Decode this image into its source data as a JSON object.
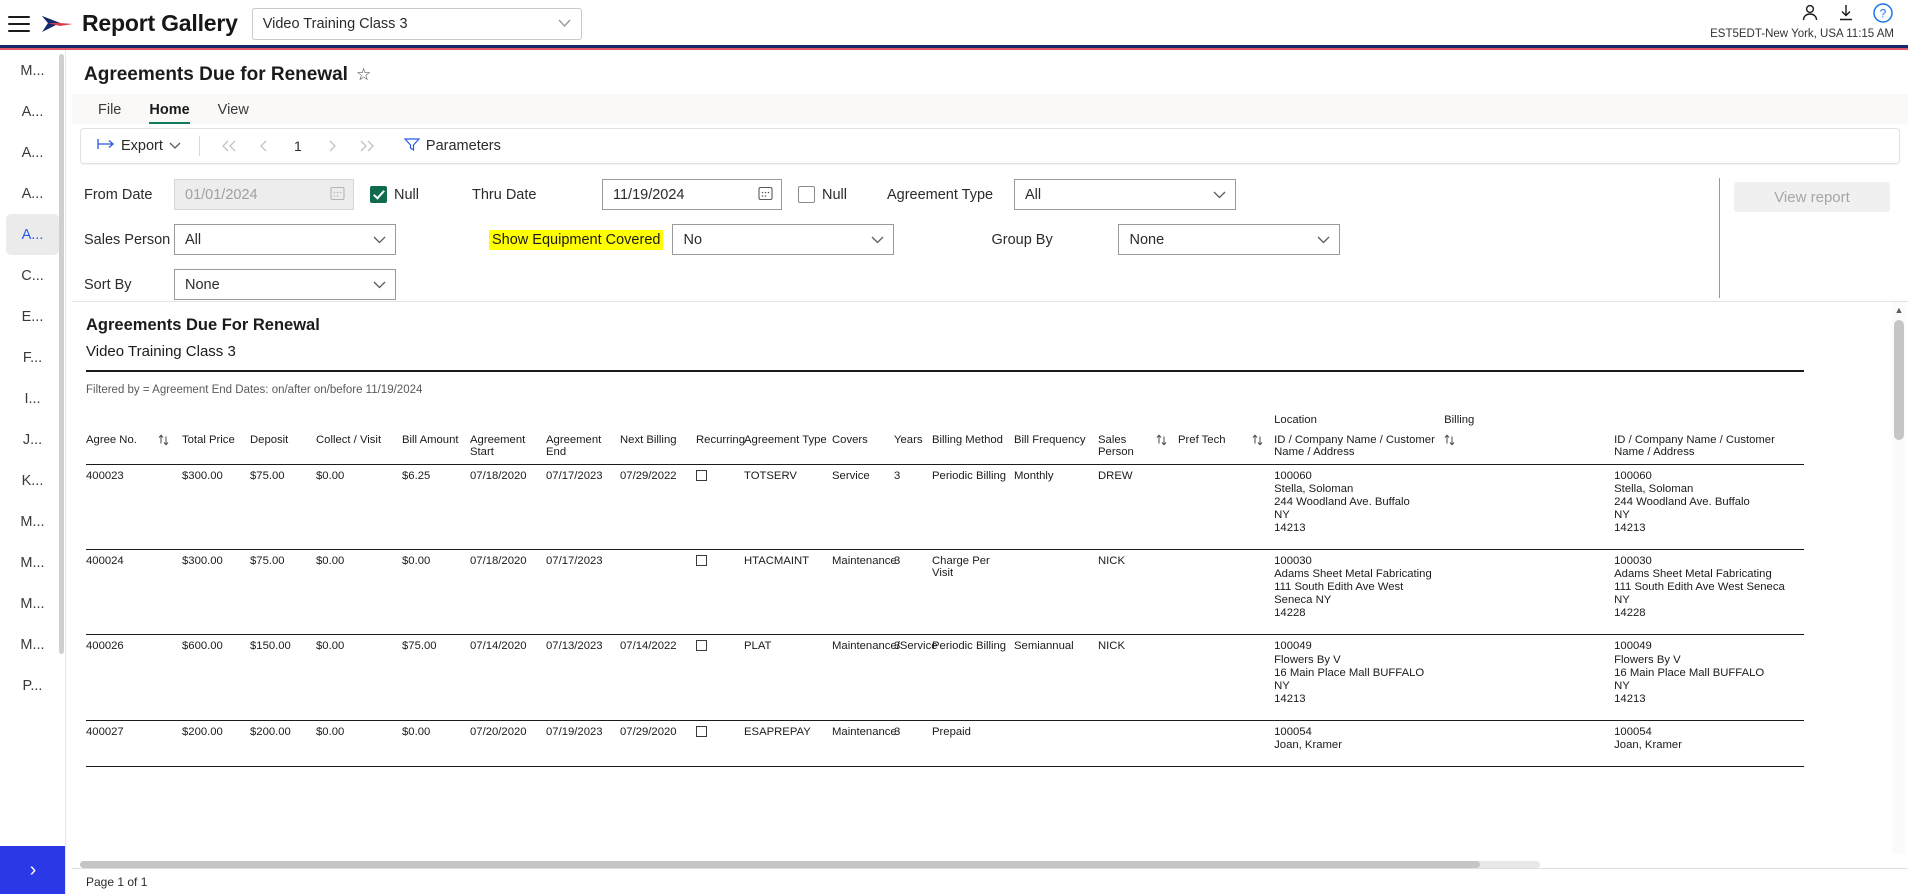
{
  "appbar": {
    "menu_icon": "hamburger-icon",
    "brand": "Report Gallery",
    "class_selector_value": "Video Training Class 3",
    "account_icon": "person-icon",
    "download_icon": "download-icon",
    "help_icon": "help-icon",
    "timezone": "EST5EDT-New York, USA 11:15 AM"
  },
  "rail": {
    "items": [
      {
        "label": "M...",
        "active": false
      },
      {
        "label": "A...",
        "active": false
      },
      {
        "label": "A...",
        "active": false
      },
      {
        "label": "A...",
        "active": false
      },
      {
        "label": "A...",
        "active": true
      },
      {
        "label": "C...",
        "active": false
      },
      {
        "label": "E...",
        "active": false
      },
      {
        "label": "F...",
        "active": false
      },
      {
        "label": "I...",
        "active": false
      },
      {
        "label": "J...",
        "active": false
      },
      {
        "label": "K...",
        "active": false
      },
      {
        "label": "M...",
        "active": false
      },
      {
        "label": "M...",
        "active": false
      },
      {
        "label": "M...",
        "active": false
      },
      {
        "label": "M...",
        "active": false
      },
      {
        "label": "P...",
        "active": false
      }
    ],
    "expand_label": "›"
  },
  "report": {
    "title": "Agreements Due for Renewal",
    "favorite_icon": "star-icon",
    "tabs": [
      {
        "label": "File",
        "active": false
      },
      {
        "label": "Home",
        "active": true
      },
      {
        "label": "View",
        "active": false
      }
    ],
    "toolbar": {
      "export_label": "Export",
      "page_number": "1",
      "parameters_label": "Parameters",
      "first_icon": "first-page-icon",
      "prev_icon": "previous-page-icon",
      "next_icon": "next-page-icon",
      "last_icon": "last-page-icon",
      "filter_icon": "filter-icon"
    }
  },
  "parameters": {
    "from_date": {
      "label": "From Date",
      "value": "01/01/2024",
      "null_label": "Null",
      "null_checked": true,
      "disabled": true
    },
    "thru_date": {
      "label": "Thru Date",
      "value": "11/19/2024",
      "null_label": "Null",
      "null_checked": false,
      "disabled": false
    },
    "agreement_type": {
      "label": "Agreement Type",
      "value": "All"
    },
    "sales_person": {
      "label": "Sales Person",
      "value": "All"
    },
    "show_equipment_covered": {
      "label": "Show Equipment Covered",
      "value": "No",
      "highlighted": true
    },
    "group_by": {
      "label": "Group By",
      "value": "None"
    },
    "sort_by": {
      "label": "Sort By",
      "value": "None"
    },
    "view_report_button": "View report"
  },
  "report_body": {
    "heading": "Agreements Due For Renewal",
    "subheading": "Video Training Class 3",
    "filter_text": "Filtered by =  Agreement End Dates: on/after  on/before 11/19/2024",
    "group_headers": {
      "location": "Location",
      "billing": "Billing"
    },
    "columns": [
      {
        "label": "Agree No.",
        "sortable": true
      },
      {
        "label": "Total Price",
        "sortable": false
      },
      {
        "label": "Deposit",
        "sortable": false
      },
      {
        "label": "Collect / Visit",
        "sortable": false
      },
      {
        "label": "Bill Amount",
        "sortable": false
      },
      {
        "label": "Agreement Start",
        "sortable": false
      },
      {
        "label": "Agreement End",
        "sortable": false
      },
      {
        "label": "Next Billing",
        "sortable": false
      },
      {
        "label": "Recurring",
        "sortable": false
      },
      {
        "label": "Agreement Type",
        "sortable": false
      },
      {
        "label": "Covers",
        "sortable": false
      },
      {
        "label": "Years",
        "sortable": false
      },
      {
        "label": "Billing Method",
        "sortable": false
      },
      {
        "label": "Bill Frequency",
        "sortable": false
      },
      {
        "label": "Sales Person",
        "sortable": true
      },
      {
        "label": "Pref Tech",
        "sortable": true
      },
      {
        "label": "ID / Company Name / Customer Name / Address",
        "sortable": true
      },
      {
        "label": "ID / Company Name / Customer Name / Address",
        "sortable": false
      }
    ],
    "rows": [
      {
        "agree_no": "400023",
        "total_price": "$300.00",
        "deposit": "$75.00",
        "collect_visit": "$0.00",
        "bill_amount": "$6.25",
        "agreement_start": "07/18/2020",
        "agreement_end": "07/17/2023",
        "next_billing": "07/29/2022",
        "recurring": false,
        "agreement_type": "TOTSERV",
        "covers": "Service",
        "years": "3",
        "billing_method": "Periodic Billing",
        "bill_frequency": "Monthly",
        "sales_person": "DREW",
        "pref_tech": "",
        "location": [
          "100060",
          "Stella, Soloman",
          "244 Woodland Ave. Buffalo",
          "NY",
          "14213"
        ],
        "billing": [
          "100060",
          "Stella, Soloman",
          "244 Woodland Ave. Buffalo",
          "NY",
          "14213"
        ]
      },
      {
        "agree_no": "400024",
        "total_price": "$300.00",
        "deposit": "$75.00",
        "collect_visit": "$0.00",
        "bill_amount": "$0.00",
        "agreement_start": "07/18/2020",
        "agreement_end": "07/17/2023",
        "next_billing": "",
        "recurring": false,
        "agreement_type": "HTACMAINT",
        "covers": "Maintenance",
        "years": "3",
        "billing_method": "Charge Per Visit",
        "bill_frequency": "",
        "sales_person": "NICK",
        "pref_tech": "",
        "location": [
          "100030",
          "Adams Sheet Metal Fabricating",
          "111 South Edith Ave West Seneca NY",
          "14228"
        ],
        "billing": [
          "100030",
          "Adams Sheet Metal Fabricating",
          "111 South Edith Ave West Seneca NY",
          "14228"
        ]
      },
      {
        "agree_no": "400026",
        "total_price": "$600.00",
        "deposit": "$150.00",
        "collect_visit": "$0.00",
        "bill_amount": "$75.00",
        "agreement_start": "07/14/2020",
        "agreement_end": "07/13/2023",
        "next_billing": "07/14/2022",
        "recurring": false,
        "agreement_type": "PLAT",
        "covers": "Maintenance/Service",
        "years": "3",
        "billing_method": "Periodic Billing",
        "bill_frequency": "Semiannual",
        "sales_person": "NICK",
        "pref_tech": "",
        "location": [
          "100049",
          "Flowers By V",
          "16 Main Place Mall BUFFALO",
          "NY",
          "14213"
        ],
        "billing": [
          "100049",
          "Flowers By V",
          "16 Main Place Mall BUFFALO",
          "NY",
          "14213"
        ]
      },
      {
        "agree_no": "400027",
        "total_price": "$200.00",
        "deposit": "$200.00",
        "collect_visit": "$0.00",
        "bill_amount": "$0.00",
        "agreement_start": "07/20/2020",
        "agreement_end": "07/19/2023",
        "next_billing": "07/29/2020",
        "recurring": false,
        "agreement_type": "ESAPREPAY",
        "covers": "Maintenance",
        "years": "3",
        "billing_method": "Prepaid",
        "bill_frequency": "",
        "sales_person": "",
        "pref_tech": "",
        "location": [
          "100054",
          "Joan, Kramer"
        ],
        "billing": [
          "100054",
          "Joan, Kramer"
        ]
      }
    ],
    "footer": "Page 1 of 1"
  },
  "colors": {
    "brand_navy": "#14296b",
    "brand_red": "#e2566a",
    "accent_green": "#107a5e",
    "rail_active_blue": "#2b59e8",
    "highlight_yellow": "#ffff00"
  }
}
